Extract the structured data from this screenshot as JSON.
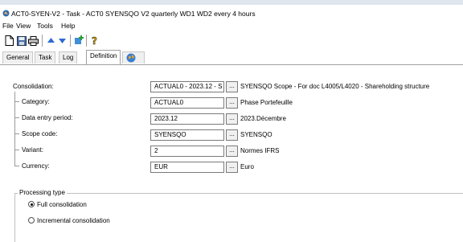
{
  "window": {
    "title": "ACT0-SYEN-V2 - Task - ACT0 SYENSQO  V2 quarterly WD1 WD2 every 4 hours"
  },
  "menu": [
    "File",
    "View",
    "Tools",
    "Help"
  ],
  "toolbar": {
    "icons": [
      "new-document-icon",
      "save-icon",
      "print-icon",
      "arrow-up-icon",
      "arrow-down-icon",
      "add-task-icon",
      "help-icon"
    ]
  },
  "tabs": [
    {
      "label": "General"
    },
    {
      "label": "Task"
    },
    {
      "label": "Log"
    },
    {
      "label": "Definition",
      "active": true
    }
  ],
  "form": {
    "consolidation": {
      "label": "Consolidation:",
      "value": "ACTUAL0 - 2023.12 - S",
      "description": "SYENSQO Scope - For doc L4005/L4020 - Shareholding structure"
    },
    "category": {
      "label": "Category:",
      "value": "ACTUAL0",
      "description": "Phase Portefeuille"
    },
    "data_entry_period": {
      "label": "Data entry period:",
      "value": "2023.12",
      "description": "2023.Décembre"
    },
    "scope_code": {
      "label": "Scope code:",
      "value": "SYENSQO",
      "description": "SYENSQO"
    },
    "variant": {
      "label": "Variant:",
      "value": "2",
      "description": "Normes IFRS"
    },
    "currency": {
      "label": "Currency:",
      "value": "EUR",
      "description": "Euro"
    },
    "browse_label": "..."
  },
  "processing": {
    "group_label": "Processing type",
    "options": [
      {
        "label": "Full consolidation",
        "selected": true
      },
      {
        "label": "Incremental consolidation",
        "selected": false
      }
    ]
  }
}
